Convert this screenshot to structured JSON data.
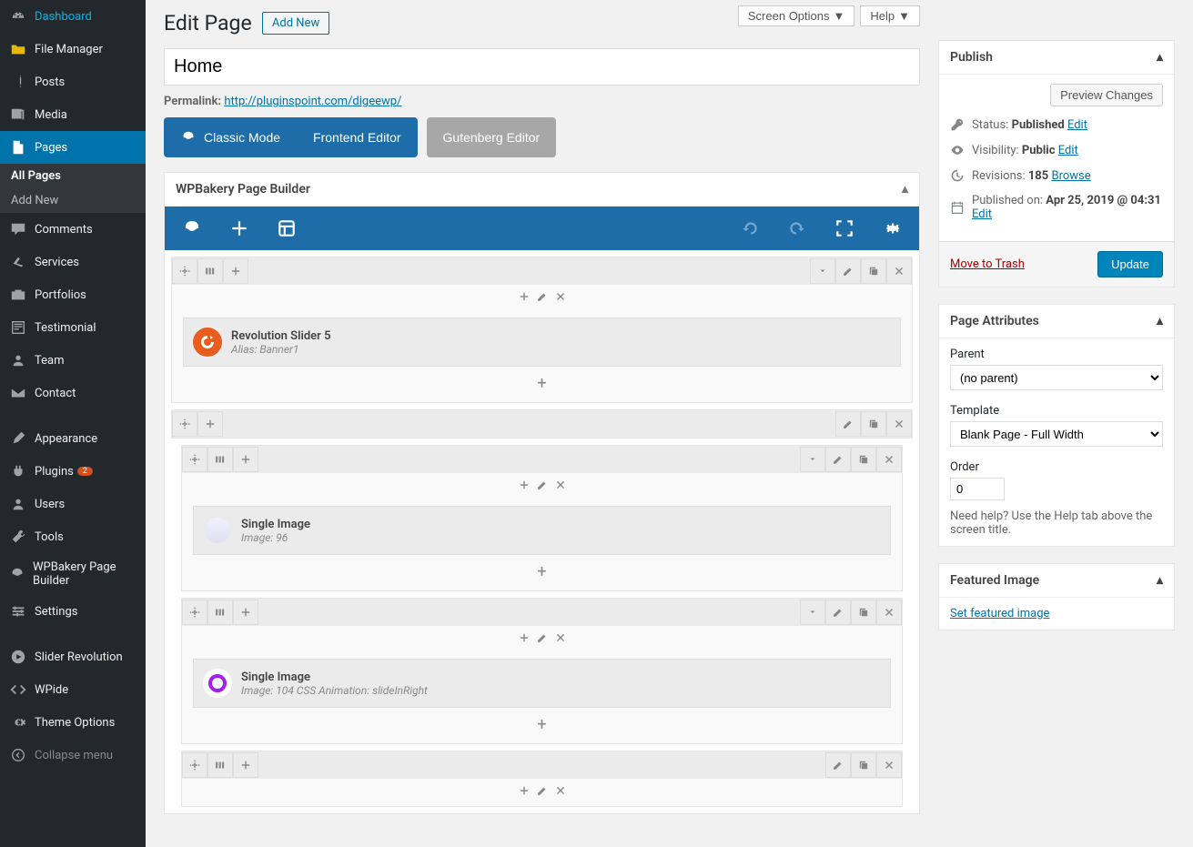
{
  "topRight": {
    "screenOptions": "Screen Options",
    "help": "Help"
  },
  "sidebar": {
    "items": [
      {
        "label": "Dashboard"
      },
      {
        "label": "File Manager"
      },
      {
        "label": "Posts"
      },
      {
        "label": "Media"
      },
      {
        "label": "Pages"
      },
      {
        "label": "Comments"
      },
      {
        "label": "Services"
      },
      {
        "label": "Portfolios"
      },
      {
        "label": "Testimonial"
      },
      {
        "label": "Team"
      },
      {
        "label": "Contact"
      },
      {
        "label": "Appearance"
      },
      {
        "label": "Plugins"
      },
      {
        "label": "Users"
      },
      {
        "label": "Tools"
      },
      {
        "label": "WPBakery Page Builder"
      },
      {
        "label": "Settings"
      },
      {
        "label": "Slider Revolution"
      },
      {
        "label": "WPide"
      },
      {
        "label": "Theme Options"
      },
      {
        "label": "Collapse menu"
      }
    ],
    "pluginBadge": "2",
    "sub": {
      "allPages": "All Pages",
      "addNew": "Add New"
    }
  },
  "header": {
    "title": "Edit Page",
    "addNew": "Add New"
  },
  "titleInput": "Home",
  "permalink": {
    "label": "Permalink:",
    "url": "http://pluginspoint.com/digeewp/"
  },
  "modes": {
    "classic": "Classic Mode",
    "frontend": "Frontend Editor",
    "gutenberg": "Gutenberg Editor"
  },
  "wpb": {
    "panelTitle": "WPBakery Page Builder",
    "rows": [
      {
        "element": {
          "name": "Revolution Slider 5",
          "desc": "Alias: Banner1",
          "iconBg": "#e85c1e"
        }
      },
      {
        "element": null
      },
      {
        "inner": true,
        "element": {
          "name": "Single Image",
          "desc": "Image: 96",
          "iconBg": "#e8e8f5"
        }
      },
      {
        "inner": true,
        "element": {
          "name": "Single Image",
          "desc": "Image: 104  CSS Animation: slideInRight",
          "iconBg": "#a020f0"
        }
      },
      {
        "inner": true,
        "element": null
      }
    ]
  },
  "publish": {
    "title": "Publish",
    "preview": "Preview Changes",
    "statusLabel": "Status:",
    "statusValue": "Published",
    "editLink": "Edit",
    "visibilityLabel": "Visibility:",
    "visibilityValue": "Public",
    "revisionsLabel": "Revisions:",
    "revisionsValue": "185",
    "browseLink": "Browse",
    "publishedLabel": "Published on:",
    "publishedValue": "Apr 25, 2019 @ 04:31",
    "trash": "Move to Trash",
    "update": "Update"
  },
  "attributes": {
    "title": "Page Attributes",
    "parentLabel": "Parent",
    "parentValue": "(no parent)",
    "templateLabel": "Template",
    "templateValue": "Blank Page - Full Width",
    "orderLabel": "Order",
    "orderValue": "0",
    "help": "Need help? Use the Help tab above the screen title."
  },
  "featured": {
    "title": "Featured Image",
    "link": "Set featured image"
  }
}
